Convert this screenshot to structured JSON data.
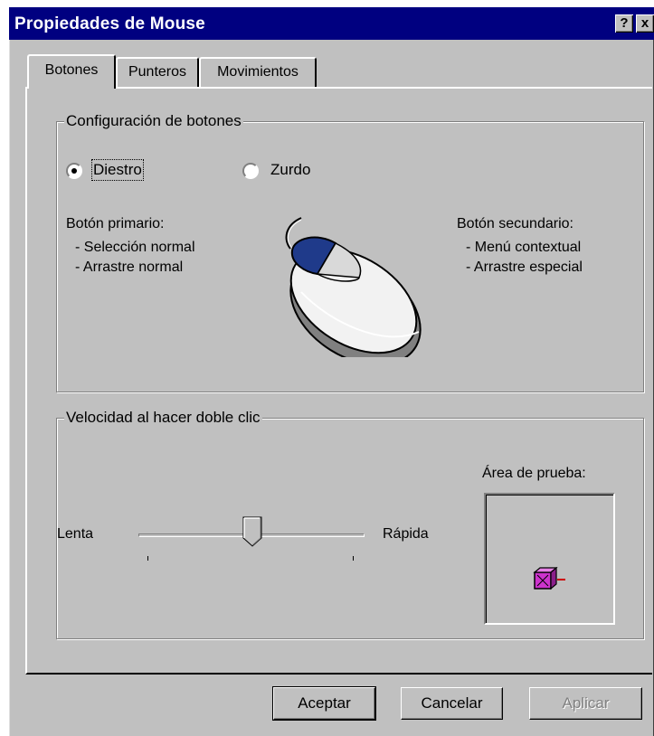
{
  "window": {
    "title": "Propiedades de Mouse",
    "help_glyph": "?",
    "close_glyph": "x"
  },
  "tabs": [
    {
      "label": "Botones",
      "active": true
    },
    {
      "label": "Punteros",
      "active": false
    },
    {
      "label": "Movimientos",
      "active": false
    }
  ],
  "buttons_config": {
    "legend": "Configuración de botones",
    "options": [
      {
        "label": "Diestro",
        "selected": true
      },
      {
        "label": "Zurdo",
        "selected": false
      }
    ],
    "primary": {
      "heading": "Botón primario:",
      "lines": [
        "- Selección normal",
        "- Arrastre normal"
      ]
    },
    "secondary": {
      "heading": "Botón secundario:",
      "lines": [
        "- Menú contextual",
        "- Arrastre especial"
      ]
    },
    "mouse_icon": "mouse-icon"
  },
  "double_click": {
    "legend": "Velocidad al hacer doble clic",
    "slow_label": "Lenta",
    "fast_label": "Rápida",
    "slider_value": 0.48,
    "test_area_label": "Área de prueba:",
    "test_icon": "jack-in-the-box-icon"
  },
  "actions": {
    "ok": "Aceptar",
    "cancel": "Cancelar",
    "apply": "Aplicar",
    "apply_enabled": false
  },
  "colors": {
    "titlebar": "#000080",
    "face": "#c0c0c0",
    "mouse_button": "#1f3a8a",
    "test_box": "#cc33cc"
  }
}
